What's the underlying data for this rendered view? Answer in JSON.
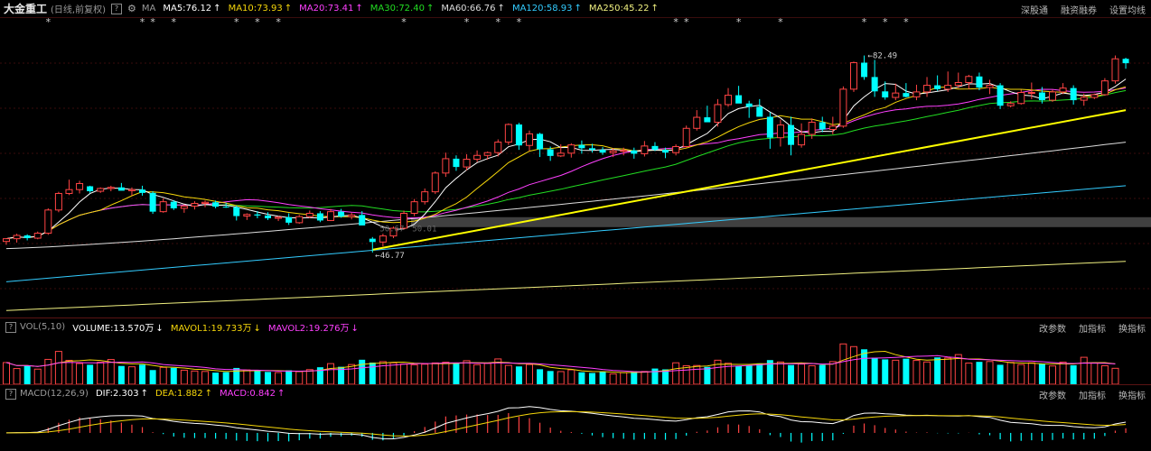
{
  "header": {
    "stock_name": "大金重工",
    "period": "(日线,前复权)",
    "help": "?",
    "ma_label": "MA",
    "indicators": [
      {
        "text": "MA5:76.12",
        "color": "#ffffff",
        "arrow": "↑"
      },
      {
        "text": "MA10:73.93",
        "color": "#f5d60a",
        "arrow": "↑"
      },
      {
        "text": "MA20:73.41",
        "color": "#ff40ff",
        "arrow": "↑"
      },
      {
        "text": "MA30:72.40",
        "color": "#22dd22",
        "arrow": "↑"
      },
      {
        "text": "MA60:66.76",
        "color": "#dddddd",
        "arrow": "↑"
      },
      {
        "text": "MA120:58.93",
        "color": "#33ccff",
        "arrow": "↑"
      },
      {
        "text": "MA250:45.22",
        "color": "#f0f080",
        "arrow": "↑"
      }
    ],
    "tools": [
      "深股通",
      "融资融券",
      "设置均线"
    ]
  },
  "volume": {
    "label": "VOL(5,10)",
    "indicators": [
      {
        "text": "VOLUME:13.570万",
        "color": "#ffffff",
        "arrow": "↓"
      },
      {
        "text": "MAVOL1:19.733万",
        "color": "#f5d60a",
        "arrow": "↓"
      },
      {
        "text": "MAVOL2:19.276万",
        "color": "#ff40ff",
        "arrow": "↓"
      }
    ],
    "tools": [
      "改参数",
      "加指标",
      "换指标"
    ]
  },
  "macd": {
    "label": "MACD(12,26,9)",
    "indicators": [
      {
        "text": "DIF:2.303",
        "color": "#ffffff",
        "arrow": "↑"
      },
      {
        "text": "DEA:1.882",
        "color": "#f5d60a",
        "arrow": "↑"
      },
      {
        "text": "MACD:0.842",
        "color": "#ff40ff",
        "arrow": "↑"
      }
    ],
    "tools": [
      "改参数",
      "加指标",
      "换指标"
    ]
  },
  "chart_data": {
    "type": "candlestick",
    "price_range": [
      36,
      87
    ],
    "high_label": "82.49",
    "low_label": "46.77",
    "support_label": "50.67",
    "support_label_ext": "50.01",
    "colors": {
      "up": "#ff4444",
      "down": "#00ffff",
      "ma5": "#ffffff",
      "ma10": "#f5d60a",
      "ma20": "#ff40ff",
      "ma30": "#22dd22",
      "ma60": "#dddddd",
      "ma120": "#33ccff",
      "ma250": "#f0f080",
      "trend": "#ffff00"
    },
    "star_glyph": "*",
    "star_indices": [
      4,
      13,
      14,
      16,
      22,
      24,
      26,
      38,
      44,
      47,
      49,
      64,
      65,
      70,
      74,
      82,
      84,
      86
    ],
    "candles": [
      [
        48.8,
        49.4,
        48.2,
        49.3
      ],
      [
        49.3,
        50.2,
        48.6,
        49.9
      ],
      [
        49.9,
        50.1,
        49.0,
        49.4
      ],
      [
        49.4,
        50.6,
        49.2,
        50.3
      ],
      [
        50.3,
        54.8,
        50.0,
        54.5
      ],
      [
        54.5,
        57.8,
        54.1,
        57.5
      ],
      [
        57.5,
        60.0,
        57.2,
        58.2
      ],
      [
        58.2,
        59.8,
        57.5,
        59.3
      ],
      [
        58.8,
        58.9,
        57.6,
        57.9
      ],
      [
        57.9,
        58.6,
        57.6,
        58.4
      ],
      [
        58.4,
        58.9,
        57.9,
        58.6
      ],
      [
        58.6,
        59.4,
        58.3,
        58.0
      ],
      [
        58.0,
        58.6,
        57.1,
        58.2
      ],
      [
        58.2,
        58.9,
        57.1,
        57.6
      ],
      [
        57.6,
        57.9,
        53.8,
        54.2
      ],
      [
        54.2,
        56.6,
        54.0,
        56.0
      ],
      [
        56.0,
        56.3,
        54.5,
        54.8
      ],
      [
        54.8,
        55.5,
        54.0,
        55.2
      ],
      [
        55.2,
        56.1,
        54.6,
        55.7
      ],
      [
        55.7,
        56.2,
        55.0,
        55.9
      ],
      [
        55.9,
        56.2,
        54.8,
        55.1
      ],
      [
        55.1,
        55.8,
        54.9,
        55.0
      ],
      [
        55.0,
        55.3,
        52.6,
        53.4
      ],
      [
        53.4,
        53.9,
        52.7,
        53.7
      ],
      [
        53.7,
        54.3,
        53.0,
        53.5
      ],
      [
        53.5,
        54.1,
        52.7,
        53.0
      ],
      [
        53.0,
        53.4,
        52.5,
        53.2
      ],
      [
        53.2,
        53.9,
        51.8,
        52.2
      ],
      [
        52.2,
        53.6,
        52.0,
        53.3
      ],
      [
        53.3,
        54.4,
        53.0,
        53.9
      ],
      [
        53.9,
        54.3,
        52.3,
        52.6
      ],
      [
        52.6,
        54.7,
        52.5,
        54.2
      ],
      [
        54.2,
        54.7,
        53.1,
        53.3
      ],
      [
        53.3,
        54.0,
        52.8,
        53.6
      ],
      [
        53.6,
        54.3,
        52.5,
        51.7
      ],
      [
        49.3,
        49.6,
        46.8,
        48.7
      ],
      [
        48.7,
        50.2,
        47.9,
        49.8
      ],
      [
        49.8,
        51.5,
        49.4,
        51.2
      ],
      [
        51.2,
        54.4,
        51.0,
        53.9
      ],
      [
        53.9,
        56.5,
        53.4,
        56.0
      ],
      [
        56.0,
        58.4,
        55.5,
        57.8
      ],
      [
        57.8,
        61.5,
        57.4,
        61.2
      ],
      [
        61.2,
        64.9,
        60.5,
        63.8
      ],
      [
        63.8,
        64.4,
        61.6,
        62.3
      ],
      [
        62.3,
        64.6,
        61.7,
        63.7
      ],
      [
        63.7,
        65.3,
        63.2,
        64.4
      ],
      [
        64.4,
        65.1,
        63.6,
        64.9
      ],
      [
        64.9,
        67.3,
        64.2,
        66.8
      ],
      [
        66.8,
        70.2,
        66.3,
        70.0
      ],
      [
        70.0,
        70.3,
        65.4,
        66.2
      ],
      [
        66.2,
        68.9,
        65.2,
        68.3
      ],
      [
        68.3,
        68.5,
        64.1,
        65.5
      ],
      [
        65.5,
        66.0,
        63.4,
        64.3
      ],
      [
        64.3,
        66.4,
        64.1,
        64.8
      ],
      [
        64.8,
        66.6,
        64.0,
        66.3
      ],
      [
        66.3,
        67.1,
        64.7,
        65.7
      ],
      [
        65.7,
        66.5,
        64.9,
        65.4
      ],
      [
        65.4,
        65.9,
        64.5,
        64.9
      ],
      [
        64.9,
        65.7,
        64.1,
        65.2
      ],
      [
        65.2,
        65.8,
        64.4,
        65.3
      ],
      [
        65.3,
        65.8,
        63.8,
        64.7
      ],
      [
        64.7,
        67.0,
        64.2,
        66.1
      ],
      [
        66.1,
        66.8,
        65.2,
        65.4
      ],
      [
        65.4,
        65.8,
        63.9,
        64.9
      ],
      [
        64.9,
        66.4,
        64.4,
        66.0
      ],
      [
        66.0,
        69.8,
        65.8,
        69.3
      ],
      [
        69.3,
        72.6,
        68.9,
        71.3
      ],
      [
        71.3,
        73.4,
        71.0,
        70.4
      ],
      [
        70.4,
        74.6,
        69.6,
        73.6
      ],
      [
        73.6,
        76.6,
        73.2,
        75.3
      ],
      [
        75.3,
        77.0,
        74.5,
        73.8
      ],
      [
        73.8,
        74.3,
        71.2,
        73.2
      ],
      [
        73.2,
        74.6,
        72.2,
        71.4
      ],
      [
        71.4,
        72.2,
        65.6,
        67.6
      ],
      [
        67.6,
        70.9,
        66.0,
        69.9
      ],
      [
        69.9,
        71.4,
        64.4,
        66.3
      ],
      [
        66.3,
        70.2,
        65.8,
        68.2
      ],
      [
        68.2,
        71.1,
        67.4,
        70.4
      ],
      [
        70.4,
        71.4,
        68.6,
        69.1
      ],
      [
        69.1,
        71.4,
        68.2,
        69.7
      ],
      [
        69.7,
        76.9,
        69.4,
        76.4
      ],
      [
        76.4,
        81.4,
        75.9,
        81.2
      ],
      [
        81.2,
        82.5,
        78.1,
        78.6
      ],
      [
        78.6,
        81.7,
        75.0,
        76.0
      ],
      [
        76.0,
        77.8,
        74.5,
        74.9
      ],
      [
        74.9,
        77.4,
        74.4,
        75.7
      ],
      [
        75.7,
        77.5,
        74.9,
        75.0
      ],
      [
        75.0,
        77.2,
        74.4,
        75.9
      ],
      [
        75.9,
        78.6,
        75.0,
        77.1
      ],
      [
        77.1,
        78.9,
        76.1,
        76.4
      ],
      [
        76.4,
        79.6,
        75.9,
        77.1
      ],
      [
        77.1,
        79.4,
        76.6,
        77.6
      ],
      [
        77.6,
        79.0,
        76.4,
        78.7
      ],
      [
        78.7,
        79.4,
        76.2,
        76.7
      ],
      [
        76.7,
        78.1,
        75.5,
        77.1
      ],
      [
        77.1,
        77.5,
        72.8,
        73.4
      ],
      [
        73.4,
        74.2,
        73.1,
        73.8
      ],
      [
        73.8,
        76.3,
        73.6,
        75.8
      ],
      [
        75.8,
        77.6,
        74.6,
        75.8
      ],
      [
        75.8,
        76.8,
        73.8,
        74.4
      ],
      [
        74.4,
        76.3,
        74.1,
        75.9
      ],
      [
        75.9,
        77.5,
        75.5,
        76.6
      ],
      [
        76.6,
        77.1,
        73.6,
        74.4
      ],
      [
        74.4,
        75.6,
        73.4,
        74.9
      ],
      [
        74.9,
        75.6,
        74.6,
        75.4
      ],
      [
        75.4,
        78.4,
        75.2,
        77.9
      ],
      [
        77.9,
        82.5,
        77.4,
        81.9
      ],
      [
        81.9,
        82.1,
        80.1,
        81.1
      ]
    ],
    "volume_range": [
      0,
      40
    ],
    "volumes": [
      18.5,
      13.4,
      15.9,
      12.9,
      21.2,
      28.0,
      20.4,
      17.7,
      16.6,
      18.8,
      21.1,
      15.6,
      14.9,
      16.7,
      12.1,
      14.4,
      14.0,
      12.0,
      11.3,
      10.9,
      9.9,
      10.3,
      13.9,
      12.2,
      11.4,
      10.5,
      10.0,
      11.9,
      10.8,
      12.5,
      14.5,
      17.6,
      14.9,
      16.8,
      20.9,
      18.5,
      19.3,
      18.3,
      17.2,
      16.6,
      17.1,
      18.2,
      18.8,
      18.0,
      20.1,
      16.7,
      17.8,
      21.6,
      16.1,
      15.2,
      16.8,
      12.8,
      11.3,
      10.8,
      12.3,
      10.2,
      9.6,
      11.0,
      8.8,
      9.9,
      11.1,
      10.9,
      13.4,
      12.7,
      18.3,
      15.8,
      16.0,
      14.8,
      20.5,
      17.9,
      15.4,
      16.0,
      17.8,
      20.6,
      19.0,
      16.4,
      17.2,
      15.8,
      16.5,
      19.3,
      34.4,
      32.1,
      29.8,
      22.7,
      21.2,
      20.5,
      21.8,
      20.3,
      19.0,
      22.9,
      22.4,
      25.3,
      18.1,
      19.1,
      19.4,
      16.6,
      18.7,
      16.8,
      18.3,
      17.4,
      15.6,
      18.9,
      16.2,
      23.0,
      18.3,
      15.8,
      13.6
    ],
    "macd_range": [
      -2.6,
      4.4
    ]
  }
}
